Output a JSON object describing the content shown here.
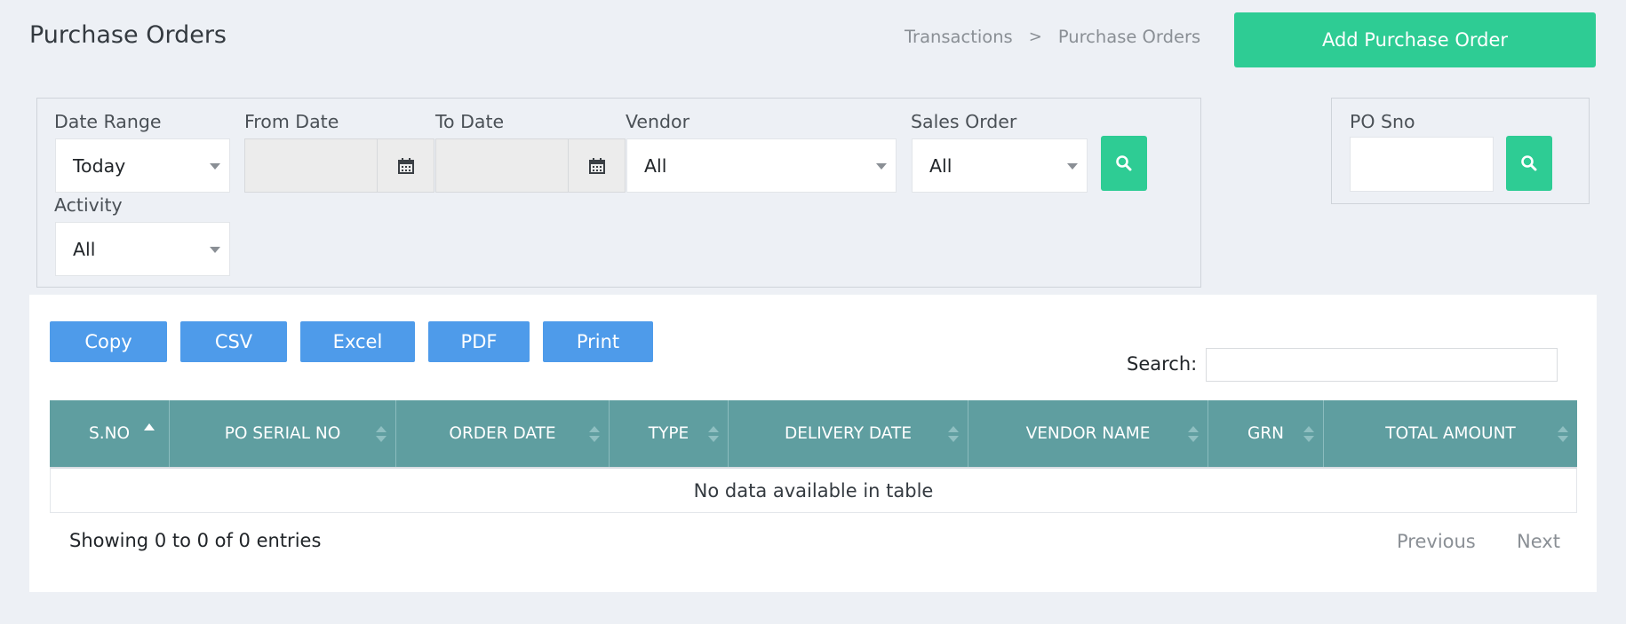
{
  "header": {
    "title": "Purchase Orders",
    "breadcrumb": [
      "Transactions",
      "Purchase Orders"
    ],
    "breadcrumb_separator": ">",
    "add_button": "Add Purchase Order"
  },
  "filters": {
    "date_range": {
      "label": "Date Range",
      "value": "Today"
    },
    "from_date": {
      "label": "From Date",
      "value": ""
    },
    "to_date": {
      "label": "To Date",
      "value": ""
    },
    "vendor": {
      "label": "Vendor",
      "value": "All"
    },
    "sales_order": {
      "label": "Sales Order",
      "value": "All"
    },
    "activity": {
      "label": "Activity",
      "value": "All"
    },
    "po_sno": {
      "label": "PO Sno",
      "value": ""
    }
  },
  "export_buttons": [
    "Copy",
    "CSV",
    "Excel",
    "PDF",
    "Print"
  ],
  "search": {
    "label": "Search:",
    "value": ""
  },
  "table": {
    "columns": [
      "S.NO",
      "PO SERIAL NO",
      "ORDER DATE",
      "TYPE",
      "DELIVERY DATE",
      "VENDOR NAME",
      "GRN",
      "TOTAL AMOUNT"
    ],
    "sorted_column": "S.NO",
    "empty_message": "No data available in table",
    "rows": []
  },
  "footer": {
    "info": "Showing 0 to 0 of 0 entries",
    "previous": "Previous",
    "next": "Next"
  },
  "colors": {
    "accent_green": "#2ecc94",
    "export_blue": "#4e9bea",
    "table_header": "#5f9ea0",
    "background": "#edf0f5"
  }
}
